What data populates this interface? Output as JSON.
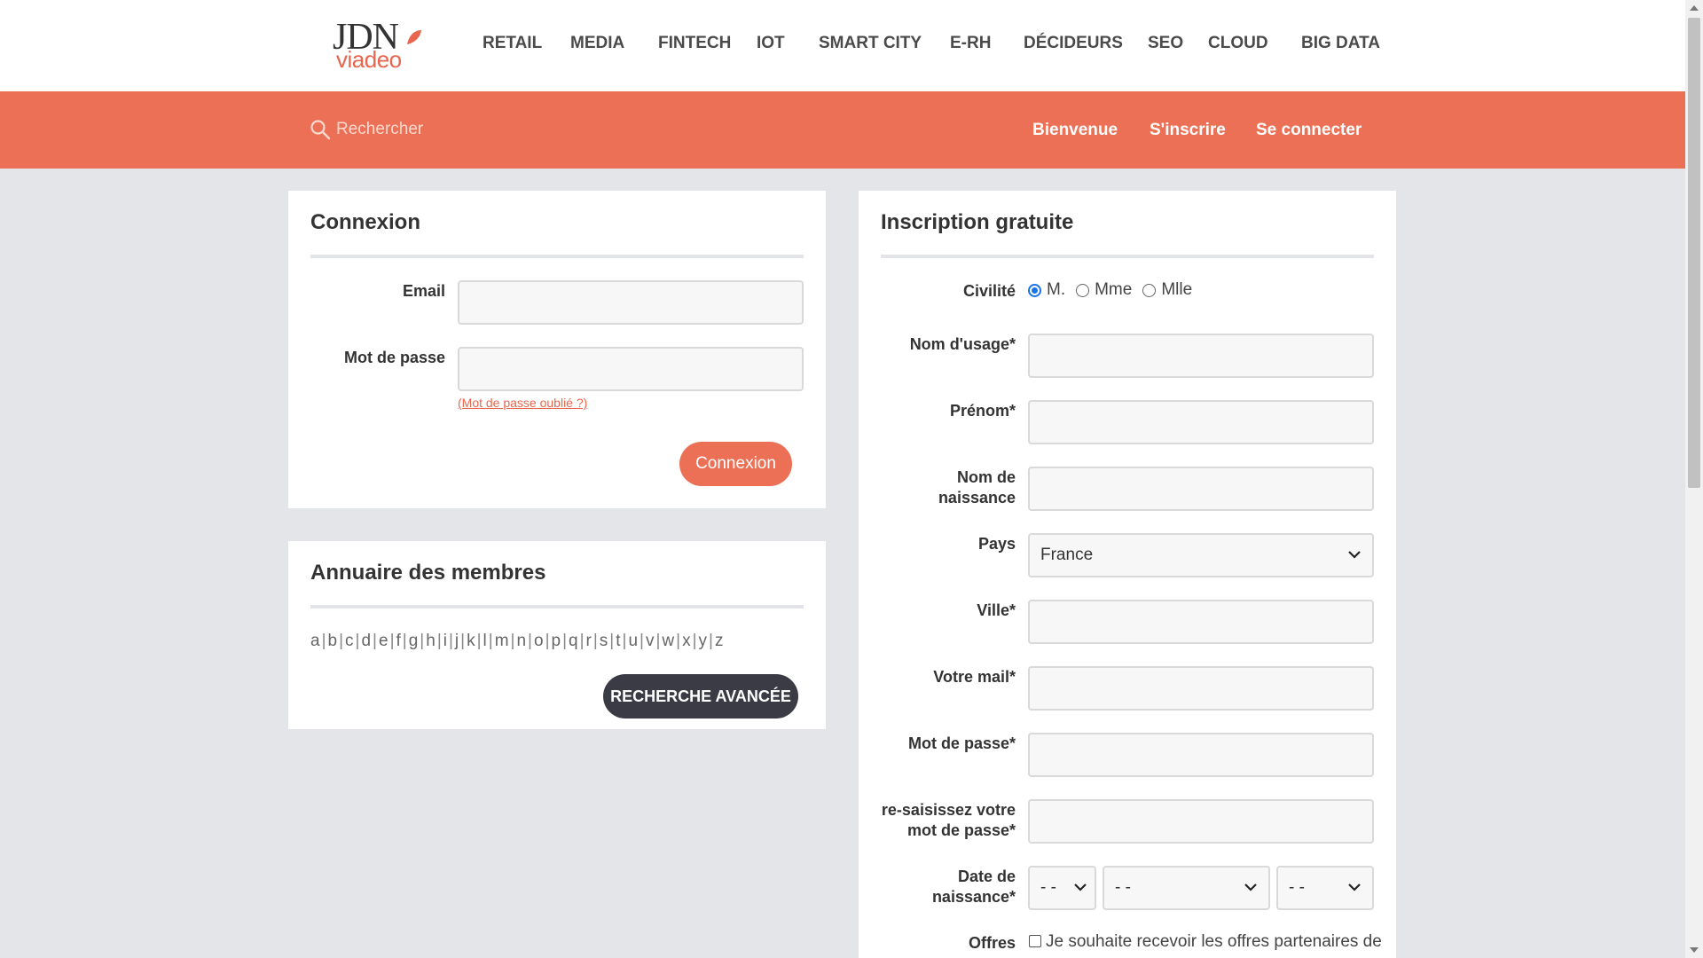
{
  "logo": {
    "line1": "JDN",
    "line2": "viadeo"
  },
  "nav": [
    "RETAIL",
    "MEDIA",
    "FINTECH",
    "IOT",
    "SMART CITY",
    "E-RH",
    "DÉCIDEURS",
    "SEO",
    "CLOUD",
    "BIG DATA"
  ],
  "bar": {
    "search_placeholder": "Rechercher",
    "links": [
      "Bienvenue",
      "S'inscrire",
      "Se connecter"
    ]
  },
  "login": {
    "title": "Connexion",
    "email_label": "Email",
    "password_label": "Mot de passe",
    "forgot": "(Mot de passe oublié ?)",
    "submit": "Connexion"
  },
  "directory": {
    "title": "Annuaire des membres",
    "letters": [
      "a",
      "b",
      "c",
      "d",
      "e",
      "f",
      "g",
      "h",
      "i",
      "j",
      "k",
      "l",
      "m",
      "n",
      "o",
      "p",
      "q",
      "r",
      "s",
      "t",
      "u",
      "v",
      "w",
      "x",
      "y",
      "z"
    ],
    "advanced": "RECHERCHE AVANCÉE"
  },
  "signup": {
    "title": "Inscription gratuite",
    "civilite_label": "Civilité",
    "civilite_options": [
      "M.",
      "Mme",
      "Mlle"
    ],
    "civilite_selected": "M.",
    "nom_usage": "Nom d'usage*",
    "prenom": "Prénom*",
    "nom_naissance": "Nom de naissance",
    "pays_label": "Pays",
    "pays_value": "France",
    "ville": "Ville*",
    "mail": "Votre mail*",
    "password": "Mot de passe*",
    "password_repeat": "re-saisissez votre mot de passe*",
    "birthdate": "Date de naissance*",
    "birth_day": "- -",
    "birth_month": "- -",
    "birth_year": "- -",
    "offres_label": "Offres",
    "offres_text": "Je souhaite recevoir les offres partenaires de"
  },
  "colors": {
    "accent": "#ec7055",
    "dark_button": "#3a3b45",
    "background": "#e3e5e9"
  }
}
